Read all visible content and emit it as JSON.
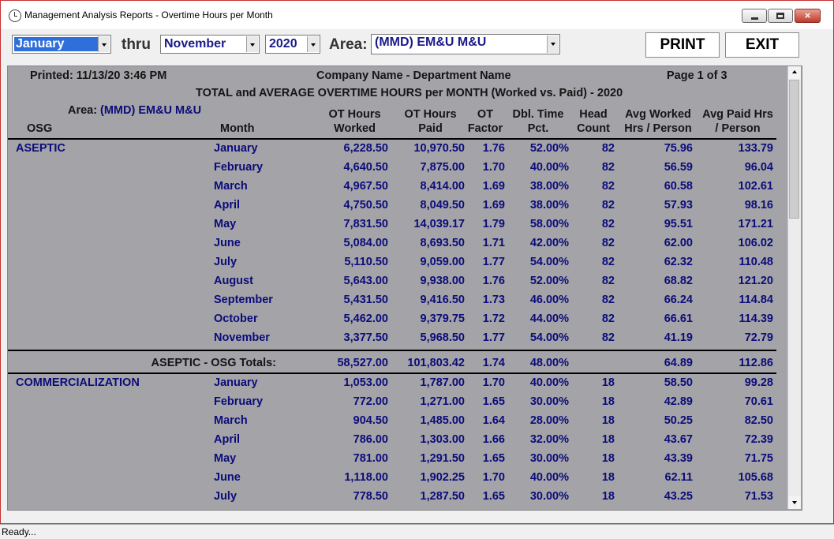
{
  "window": {
    "title": "Management Analysis Reports - Overtime Hours per Month",
    "min_icon": "minimize-icon",
    "max_icon": "maximize-icon",
    "close_label": "×",
    "app_icon": "clock-icon"
  },
  "toolbar": {
    "from_month": "January",
    "thru_label": "thru",
    "to_month": "November",
    "year": "2020",
    "area_label": "Area:",
    "area_value": "(MMD) EM&U M&U",
    "print_label": "PRINT",
    "exit_label": "EXIT"
  },
  "report": {
    "printed": "Printed:   11/13/20   3:46 PM",
    "company": "Company Name - Department Name",
    "page": "Page 1 of 3",
    "title": "TOTAL and AVERAGE OVERTIME HOURS per MONTH (Worked vs. Paid) - 2020",
    "area_label": "Area:",
    "area_value": "(MMD) EM&U M&U",
    "headers": {
      "osg": "OSG",
      "month": "Month",
      "ot_worked_1": "OT Hours",
      "ot_worked_2": "Worked",
      "ot_paid_1": "OT Hours",
      "ot_paid_2": "Paid",
      "ot_factor_1": "OT",
      "ot_factor_2": "Factor",
      "dbl_1": "Dbl. Time",
      "dbl_2": "Pct.",
      "head_1": "Head",
      "head_2": "Count",
      "avgw_1": "Avg Worked",
      "avgw_2": "Hrs / Person",
      "avgp_1": "Avg Paid Hrs",
      "avgp_2": "/ Person"
    },
    "groups": [
      {
        "osg": "ASEPTIC",
        "rows": [
          [
            "January",
            "6,228.50",
            "10,970.50",
            "1.76",
            "52.00%",
            "82",
            "75.96",
            "133.79"
          ],
          [
            "February",
            "4,640.50",
            "7,875.00",
            "1.70",
            "40.00%",
            "82",
            "56.59",
            "96.04"
          ],
          [
            "March",
            "4,967.50",
            "8,414.00",
            "1.69",
            "38.00%",
            "82",
            "60.58",
            "102.61"
          ],
          [
            "April",
            "4,750.50",
            "8,049.50",
            "1.69",
            "38.00%",
            "82",
            "57.93",
            "98.16"
          ],
          [
            "May",
            "7,831.50",
            "14,039.17",
            "1.79",
            "58.00%",
            "82",
            "95.51",
            "171.21"
          ],
          [
            "June",
            "5,084.00",
            "8,693.50",
            "1.71",
            "42.00%",
            "82",
            "62.00",
            "106.02"
          ],
          [
            "July",
            "5,110.50",
            "9,059.00",
            "1.77",
            "54.00%",
            "82",
            "62.32",
            "110.48"
          ],
          [
            "August",
            "5,643.00",
            "9,938.00",
            "1.76",
            "52.00%",
            "82",
            "68.82",
            "121.20"
          ],
          [
            "September",
            "5,431.50",
            "9,416.50",
            "1.73",
            "46.00%",
            "82",
            "66.24",
            "114.84"
          ],
          [
            "October",
            "5,462.00",
            "9,379.75",
            "1.72",
            "44.00%",
            "82",
            "66.61",
            "114.39"
          ],
          [
            "November",
            "3,377.50",
            "5,968.50",
            "1.77",
            "54.00%",
            "82",
            "41.19",
            "72.79"
          ]
        ],
        "totals": [
          "ASEPTIC - OSG Totals:",
          "58,527.00",
          "101,803.42",
          "1.74",
          "48.00%",
          "64.89",
          "112.86"
        ]
      },
      {
        "osg": "COMMERCIALIZATION",
        "rows": [
          [
            "January",
            "1,053.00",
            "1,787.00",
            "1.70",
            "40.00%",
            "18",
            "58.50",
            "99.28"
          ],
          [
            "February",
            "772.00",
            "1,271.00",
            "1.65",
            "30.00%",
            "18",
            "42.89",
            "70.61"
          ],
          [
            "March",
            "904.50",
            "1,485.00",
            "1.64",
            "28.00%",
            "18",
            "50.25",
            "82.50"
          ],
          [
            "April",
            "786.00",
            "1,303.00",
            "1.66",
            "32.00%",
            "18",
            "43.67",
            "72.39"
          ],
          [
            "May",
            "781.00",
            "1,291.50",
            "1.65",
            "30.00%",
            "18",
            "43.39",
            "71.75"
          ],
          [
            "June",
            "1,118.00",
            "1,902.25",
            "1.70",
            "40.00%",
            "18",
            "62.11",
            "105.68"
          ],
          [
            "July",
            "778.50",
            "1,287.50",
            "1.65",
            "30.00%",
            "18",
            "43.25",
            "71.53"
          ]
        ]
      }
    ]
  },
  "status": {
    "text": "Ready..."
  }
}
